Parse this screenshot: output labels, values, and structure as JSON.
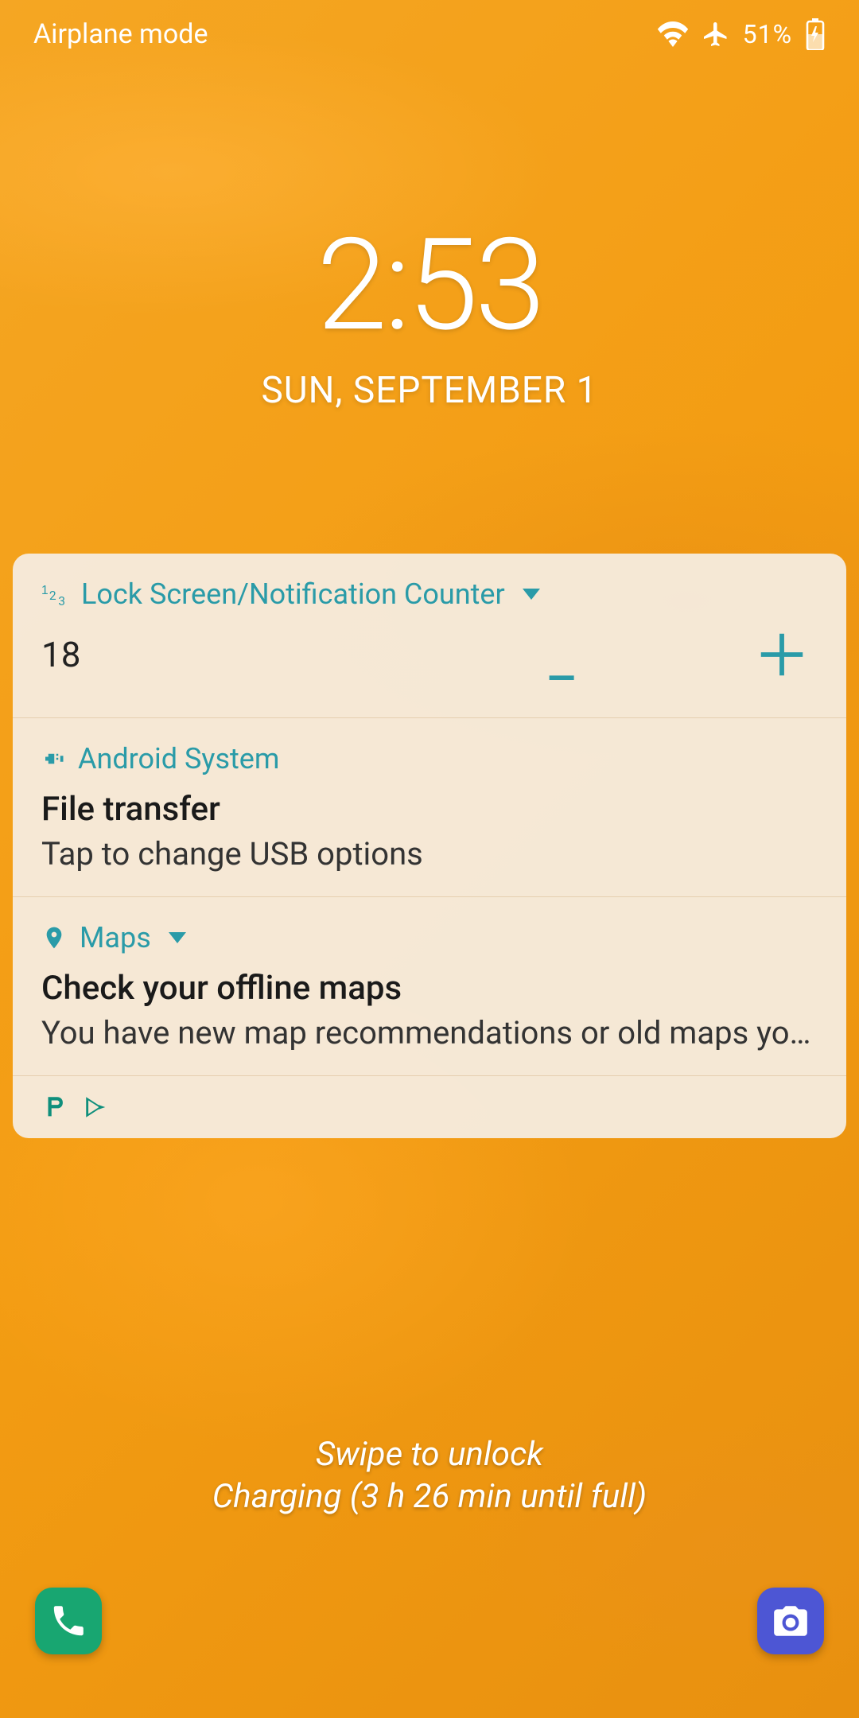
{
  "status_bar": {
    "left_text": "Airplane mode",
    "battery_pct": "51%"
  },
  "clock": {
    "time": "2:53",
    "date": "SUN, SEPTEMBER 1"
  },
  "notifications": {
    "counter": {
      "app_name": "Lock Screen/Notification Counter",
      "value": "18"
    },
    "system": {
      "app_name": "Android System",
      "title": "File transfer",
      "body": "Tap to change USB options"
    },
    "maps": {
      "app_name": "Maps",
      "title": "Check your offline maps",
      "body": "You have new map recommendations or old maps you ma…"
    }
  },
  "bottom": {
    "swipe_text": "Swipe to unlock",
    "charging_text": "Charging (3 h 26 min until full)"
  },
  "colors": {
    "accent_teal": "#2a9ba8",
    "phone_green": "#18a671",
    "camera_purple": "#4d56d4"
  }
}
